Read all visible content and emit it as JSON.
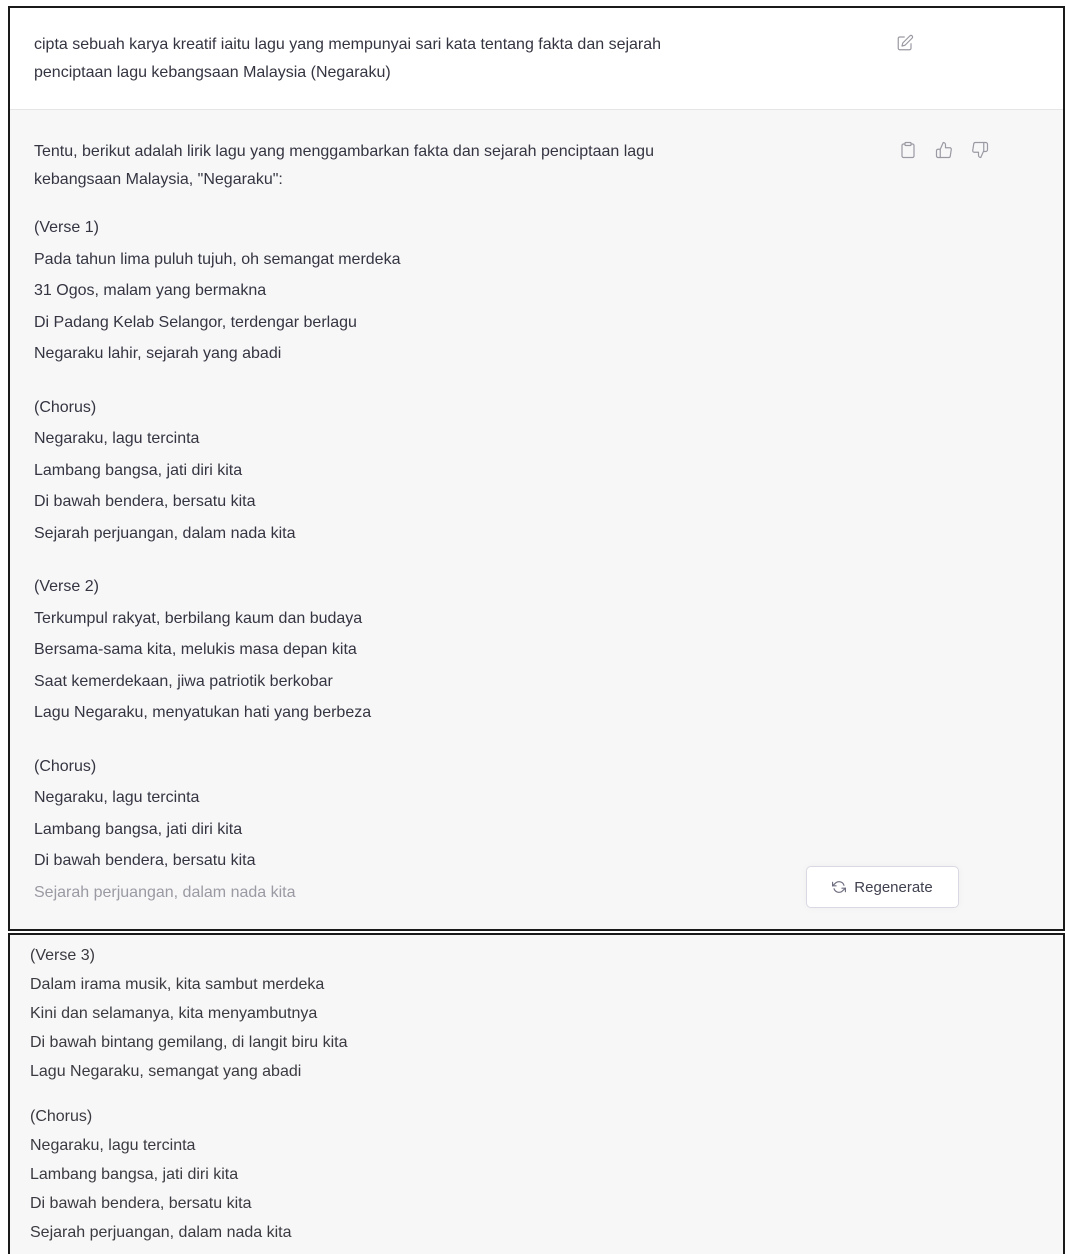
{
  "user_message": {
    "text_line1": "cipta sebuah karya kreatif iaitu lagu yang mempunyai sari kata tentang fakta dan sejarah",
    "text_line2": "penciptaan lagu kebangsaan Malaysia (Negaraku)",
    "edit_icon": "edit-icon"
  },
  "assistant_message": {
    "intro_line1": "Tentu, berikut adalah lirik lagu yang menggambarkan fakta dan sejarah penciptaan lagu",
    "intro_line2": "kebangsaan Malaysia, \"Negaraku\":",
    "icons": [
      "clipboard-icon",
      "thumbs-up-icon",
      "thumbs-down-icon"
    ],
    "verse1": {
      "heading": "(Verse 1)",
      "lines": [
        "Pada tahun lima puluh tujuh, oh semangat merdeka",
        "31 Ogos, malam yang bermakna",
        "Di Padang Kelab Selangor, terdengar berlagu",
        "Negaraku lahir, sejarah yang abadi"
      ]
    },
    "chorus1": {
      "heading": "(Chorus)",
      "lines": [
        "Negaraku, lagu tercinta",
        "Lambang bangsa, jati diri kita",
        "Di bawah bendera, bersatu kita",
        "Sejarah perjuangan, dalam nada kita"
      ]
    },
    "verse2": {
      "heading": "(Verse 2)",
      "lines": [
        "Terkumpul rakyat, berbilang kaum dan budaya",
        "Bersama-sama kita, melukis masa depan kita",
        "Saat kemerdekaan, jiwa patriotik berkobar",
        "Lagu Negaraku, menyatukan hati yang berbeza"
      ]
    },
    "chorus2": {
      "heading": "(Chorus)",
      "lines": [
        "Negaraku, lagu tercinta",
        "Lambang bangsa, jati diri kita",
        "Di bawah bendera, bersatu kita",
        "Sejarah perjuangan, dalam nada kita"
      ]
    },
    "regenerate_label": "Regenerate",
    "regenerate_icon": "refresh-icon"
  },
  "continuation": {
    "verse3": {
      "heading": "(Verse 3)",
      "lines": [
        "Dalam irama musik, kita sambut merdeka",
        "Kini dan selamanya, kita menyambutnya",
        "Di bawah bintang gemilang, di langit biru kita",
        "Lagu Negaraku, semangat yang abadi"
      ]
    },
    "chorus3": {
      "heading": "(Chorus)",
      "lines": [
        "Negaraku, lagu tercinta",
        "Lambang bangsa, jati diri kita",
        "Di bawah bendera, bersatu kita",
        "Sejarah perjuangan, dalam nada kita"
      ]
    }
  }
}
